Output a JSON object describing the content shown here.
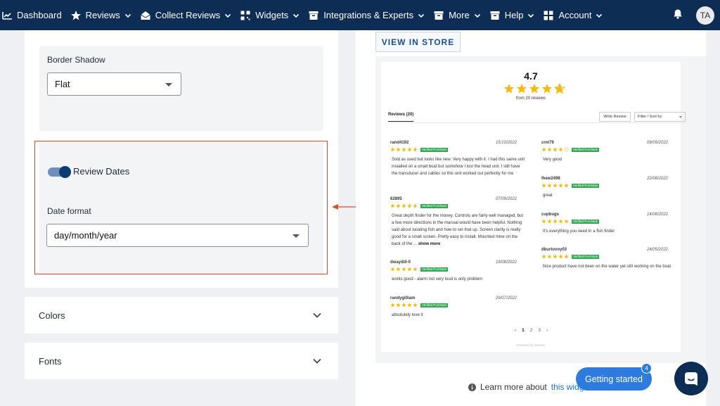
{
  "nav": {
    "items": [
      {
        "label": "Dashboard",
        "icon": "chart-icon",
        "has_menu": false
      },
      {
        "label": "Reviews",
        "icon": "star-icon",
        "has_menu": true
      },
      {
        "label": "Collect Reviews",
        "icon": "mail-open-icon",
        "has_menu": true
      },
      {
        "label": "Widgets",
        "icon": "qr-icon",
        "has_menu": true
      },
      {
        "label": "Integrations & Experts",
        "icon": "box-icon",
        "has_menu": true
      },
      {
        "label": "More",
        "icon": "box-icon",
        "has_menu": true
      },
      {
        "label": "Help",
        "icon": "box-icon",
        "has_menu": true
      },
      {
        "label": "Account",
        "icon": "grid-icon",
        "has_menu": true
      }
    ],
    "avatar": "TA"
  },
  "settings": {
    "border_shadow_label": "Border Shadow",
    "border_shadow_value": "Flat",
    "review_dates_label": "Review Dates",
    "review_dates_on": true,
    "date_format_label": "Date format",
    "date_format_value": "day/month/year",
    "colors_label": "Colors",
    "fonts_label": "Fonts"
  },
  "preview": {
    "view_store_label": "VIEW IN STORE",
    "rating": "4.7",
    "rating_stars": 4.7,
    "from_text": "from 20 reviews",
    "tab_label": "Reviews (20)",
    "write_review_label": "Write Review",
    "filter_label": "Filter / Sort by",
    "verified_label": "Verified Purchase",
    "show_more_label": "show more",
    "reviews_left": [
      {
        "name": "rand4192",
        "date": "15/10/2022",
        "stars": 5,
        "text": "Sold as used but looks like new. Very happy with it. I had this same unit installed on a small boat but somehow I lost the head unit. I still have the transducer and cables so this unit worked out perfectly for me"
      },
      {
        "name": "62895",
        "date": "07/09/2022",
        "stars": 5,
        "text": "Great depth finder for the money. Controls are fairly well managed, but a few more directions in the manual would have been helpful. Nothing said about locating fish and how to set that up. Screen clarity is really good for a small screen. Pretty easy to install. Mounted mine on the back of the ..."
      },
      {
        "name": "dwaydill-0",
        "date": "19/08/2022",
        "stars": 5,
        "text": "works good - alarm not very loud is only problem"
      },
      {
        "name": "randygilliam",
        "date": "29/07/2022",
        "stars": 5,
        "text": "absolutely love it"
      }
    ],
    "reviews_right": [
      {
        "name": "crnt76",
        "date": "09/09/2022",
        "stars": 4,
        "text": "Very good"
      },
      {
        "name": "lhew2498",
        "date": "22/08/2022",
        "stars": 5,
        "text": "great"
      },
      {
        "name": "cupbugs",
        "date": "14/08/2022",
        "stars": 5,
        "text": "It's everything you need in a fish finder"
      },
      {
        "name": "dburtovoy03",
        "date": "24/05/2022",
        "stars": 5,
        "text": "Nice product have not been on the water yet still working on the boat"
      }
    ],
    "pages": [
      "1",
      "2",
      "3"
    ],
    "current_page": "1",
    "powered_by": "Powered by Opinew"
  },
  "footer": {
    "learn_more": "Learn more about",
    "learn_link": "this widge"
  },
  "help": {
    "getting_started_label": "Getting started",
    "badge_count": "4"
  },
  "colors": {
    "nav_bg": "#0d2d55",
    "star": "#f5b90a",
    "verified": "#33a852",
    "highlight": "#e14a2c",
    "accent": "#2d7bdd"
  }
}
